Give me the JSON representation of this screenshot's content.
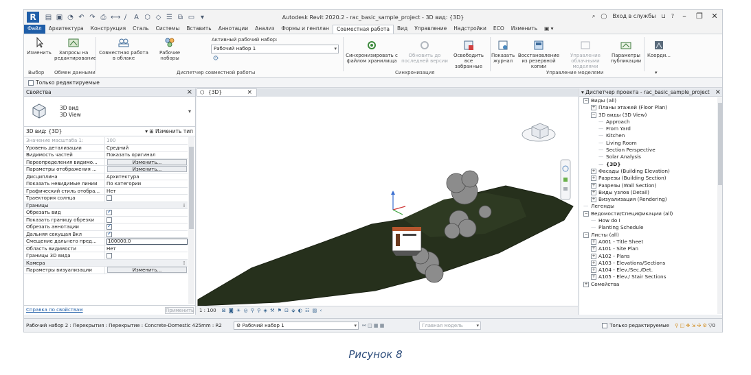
{
  "window": {
    "title": "Autodesk Revit 2020.2 - rac_basic_sample_project - 3D вид: {3D}",
    "signin": "Вход в службы",
    "help": "?"
  },
  "menu_tabs": [
    "Файл",
    "Архитектура",
    "Конструкция",
    "Сталь",
    "Системы",
    "Вставить",
    "Аннотации",
    "Анализ",
    "Формы и генплан",
    "Совместная работа",
    "Вид",
    "Управление",
    "Надстройки",
    "ECO",
    "Изменить"
  ],
  "ribbon": {
    "modify": "Изменить",
    "editing_requests": "Запросы на редактирование",
    "cloud_collab": "Совместная работа в облаке",
    "worksets": "Рабочие наборы",
    "active_ws_label": "Активный рабочий набор:",
    "active_ws_value": "Рабочий набор 1",
    "sync": "Синхронизировать с файлом хранилища",
    "reload": "Обновить до последней версии",
    "relinquish": "Освободить все забранные",
    "show_history": "Показать журнал",
    "restore_backup": "Восстановление из резервной копии",
    "manage_cloud": "Управление облачными моделями",
    "publish_settings": "Параметры публикации",
    "coordinates": "Коорди...",
    "panel_select": "Выбор",
    "panel_exchange": "Обмен данными",
    "panel_manage_collab": "Диспетчер совместной работы",
    "panel_sync": "Синхронизация",
    "panel_manage_models": "Управление моделями"
  },
  "options_bar": {
    "editable_only": "Только редактируемые"
  },
  "properties": {
    "title": "Свойства",
    "type_name_1": "3D вид",
    "type_name_2": "3D View",
    "instance": "3D вид: {3D}",
    "edit_type": "Изменить тип",
    "rows": [
      {
        "k": "Значение масштаба   1:",
        "v": "100",
        "dim": true
      },
      {
        "k": "Уровень детализации",
        "v": "Средний"
      },
      {
        "k": "Видимость частей",
        "v": "Показать оригинал"
      },
      {
        "k": "Переопределения видимо...",
        "v": "Изменить...",
        "button": true
      },
      {
        "k": "Параметры отображения ...",
        "v": "Изменить...",
        "button": true
      },
      {
        "k": "Дисциплина",
        "v": "Архитектура"
      },
      {
        "k": "Показать невидимые линии",
        "v": "По категории"
      },
      {
        "k": "Графический стиль отобра...",
        "v": "Нет"
      },
      {
        "k": "Траектория солнца",
        "check": false
      },
      {
        "group": "Границы"
      },
      {
        "k": "Обрезать вид",
        "check": true
      },
      {
        "k": "Показать границу обрезки",
        "check": false
      },
      {
        "k": "Обрезать аннотации",
        "check": true
      },
      {
        "k": "Дальняя секущая Вкл",
        "check": true
      },
      {
        "k": "Смещение дальнего пред...",
        "v": "100000.0",
        "input": true
      },
      {
        "k": "Область видимости",
        "v": "Нет"
      },
      {
        "k": "Границы 3D вида",
        "check": false
      },
      {
        "group": "Камера"
      },
      {
        "k": "Параметры визуализации",
        "v": "Изменить...",
        "button": true
      }
    ],
    "help_link": "Справка по свойствам",
    "apply": "Применить"
  },
  "view": {
    "tab_label": "{3D}",
    "scale": "1 : 100"
  },
  "project_browser": {
    "title": "Диспетчер проекта - rac_basic_sample_project",
    "nodes": [
      {
        "t": "Виды (all)",
        "lvl": 0,
        "tg": "−"
      },
      {
        "t": "Планы этажей (Floor Plan)",
        "lvl": 1,
        "tg": "+"
      },
      {
        "t": "3D виды (3D View)",
        "lvl": 1,
        "tg": "−"
      },
      {
        "t": "Approach",
        "lvl": 2
      },
      {
        "t": "From Yard",
        "lvl": 2
      },
      {
        "t": "Kitchen",
        "lvl": 2
      },
      {
        "t": "Living Room",
        "lvl": 2
      },
      {
        "t": "Section Perspective",
        "lvl": 2
      },
      {
        "t": "Solar Analysis",
        "lvl": 2
      },
      {
        "t": "{3D}",
        "lvl": 2,
        "bold": true
      },
      {
        "t": "Фасады (Building Elevation)",
        "lvl": 1,
        "tg": "+"
      },
      {
        "t": "Разрезы (Building Section)",
        "lvl": 1,
        "tg": "+"
      },
      {
        "t": "Разрезы (Wall Section)",
        "lvl": 1,
        "tg": "+"
      },
      {
        "t": "Виды узлов (Detail)",
        "lvl": 1,
        "tg": "+"
      },
      {
        "t": "Визуализация (Rendering)",
        "lvl": 1,
        "tg": "+"
      },
      {
        "t": "Легенды",
        "lvl": 0
      },
      {
        "t": "Ведомости/Спецификации (all)",
        "lvl": 0,
        "tg": "−"
      },
      {
        "t": "How do I",
        "lvl": 1
      },
      {
        "t": "Planting Schedule",
        "lvl": 1
      },
      {
        "t": "Листы (all)",
        "lvl": 0,
        "tg": "−"
      },
      {
        "t": "A001 - Title Sheet",
        "lvl": 1,
        "tg": "+"
      },
      {
        "t": "A101 - Site Plan",
        "lvl": 1,
        "tg": "+"
      },
      {
        "t": "A102 - Plans",
        "lvl": 1,
        "tg": "+"
      },
      {
        "t": "A103 - Elevations/Sections",
        "lvl": 1,
        "tg": "+"
      },
      {
        "t": "A104 - Elev./Sec./Det.",
        "lvl": 1,
        "tg": "+"
      },
      {
        "t": "A105 - Elev./ Stair Sections",
        "lvl": 1,
        "tg": "+"
      },
      {
        "t": "Семейства",
        "lvl": 0,
        "tg": "+"
      }
    ]
  },
  "status_bar": {
    "hint": "Рабочий набор 2 : Перекрытия : Перекрытие : Concrete-Domestic 425mm : R2",
    "workset": "Рабочий набор 1",
    "main_model": "Главная модель",
    "editable_only": "Только редактируемые",
    "filter_count": "0"
  },
  "caption": "Рисунок 8",
  "colors": {
    "accent": "#1f5ea8",
    "terrain": "#26301c",
    "tree": "#8a8a8a"
  }
}
